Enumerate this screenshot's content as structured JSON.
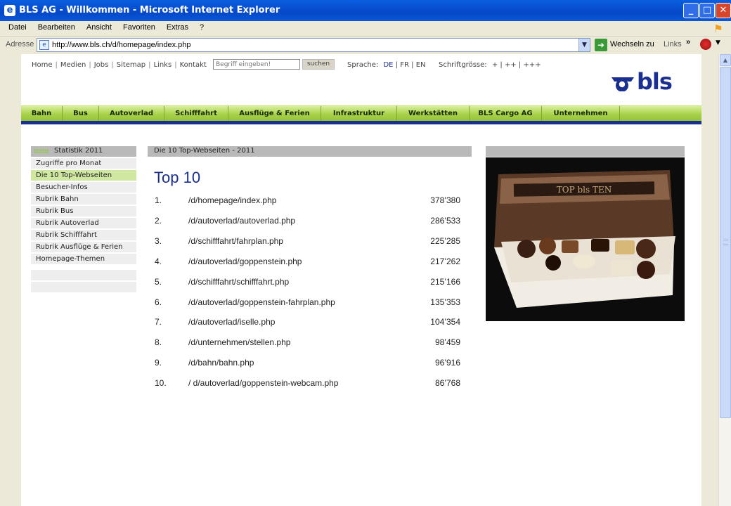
{
  "window": {
    "title": "BLS AG - Willkommen - Microsoft Internet Explorer"
  },
  "menu": [
    "Datei",
    "Bearbeiten",
    "Ansicht",
    "Favoriten",
    "Extras",
    "?"
  ],
  "address": {
    "label": "Adresse",
    "url": "http://www.bls.ch/d/homepage/index.php",
    "go_label": "Wechseln zu",
    "links_label": "Links"
  },
  "toplinks": [
    "Home",
    "Medien",
    "Jobs",
    "Sitemap",
    "Links",
    "Kontakt"
  ],
  "search": {
    "placeholder": "Begriff eingeben!",
    "button": "suchen"
  },
  "language": {
    "label": "Sprache:",
    "options": [
      "DE",
      "FR",
      "EN"
    ],
    "active": "DE"
  },
  "fontsize": {
    "label": "Schriftgrösse:",
    "options": [
      "+",
      "++",
      "+++"
    ]
  },
  "logo": {
    "text": "bls"
  },
  "nav": [
    "Bahn",
    "Bus",
    "Autoverlad",
    "Schifffahrt",
    "Ausflüge & Ferien",
    "Infrastruktur",
    "Werkstätten",
    "BLS Cargo AG",
    "Unternehmen"
  ],
  "sidebar": {
    "heading": "Statistik 2011",
    "items": [
      "Zugriffe pro Monat",
      "Die 10 Top-Webseiten",
      "Besucher-Infos",
      "Rubrik Bahn",
      "Rubrik Bus",
      "Rubrik Autoverlad",
      "Rubrik Schifffahrt",
      "Rubrik Ausflüge & Ferien",
      "Homepage-Themen"
    ],
    "active_index": 1
  },
  "main": {
    "header": "Die 10 Top-Webseiten -  2011",
    "title": "Top 10",
    "rows": [
      {
        "rank": "1.",
        "path": "/d/homepage/index.php",
        "hits": "378’380"
      },
      {
        "rank": "2.",
        "path": "/d/autoverlad/autoverlad.php",
        "hits": "286’533"
      },
      {
        "rank": "3.",
        "path": "/d/schifffahrt/fahrplan.php",
        "hits": "225’285"
      },
      {
        "rank": "4.",
        "path": "/d/autoverlad/goppenstein.php",
        "hits": "217’262"
      },
      {
        "rank": "5.",
        "path": "/d/schifffahrt/schifffahrt.php",
        "hits": "215’166"
      },
      {
        "rank": "6.",
        "path": "/d/autoverlad/goppenstein-fahrplan.php",
        "hits": "135’353"
      },
      {
        "rank": "7.",
        "path": "/d/autoverlad/iselle.php",
        "hits": "104’354"
      },
      {
        "rank": "8.",
        "path": "/d/unternehmen/stellen.php",
        "hits": "98’459"
      },
      {
        "rank": "9.",
        "path": "/d/bahn/bahn.php",
        "hits": "96’916"
      },
      {
        "rank": "10.",
        "path": "/ d/autoverlad/goppenstein-webcam.php",
        "hits": "86’768"
      }
    ]
  },
  "promo": {
    "box_text": "TOP bls TEN"
  }
}
